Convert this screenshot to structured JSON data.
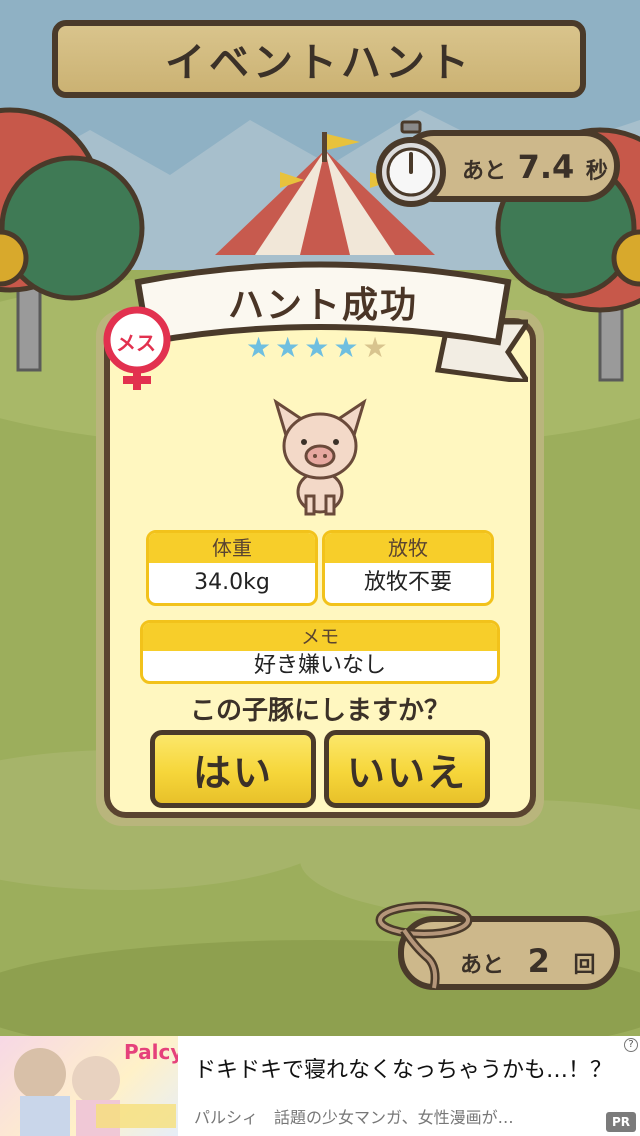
{
  "header": {
    "title": "イベントハント"
  },
  "timer": {
    "prefix": "あと",
    "value": "7.4",
    "unit": "秒"
  },
  "tries": {
    "prefix": "あと",
    "value": "2",
    "unit": "回"
  },
  "result": {
    "title": "ハント成功",
    "gender_label": "メス",
    "rating": 4,
    "rating_max": 5,
    "stars": [
      "★",
      "★",
      "★",
      "★",
      "★"
    ]
  },
  "stats": {
    "weight": {
      "label": "体重",
      "value": "34.0kg"
    },
    "grazing": {
      "label": "放牧",
      "value": "放牧不要"
    },
    "memo": {
      "label": "メモ",
      "value": "好き嫌いなし"
    }
  },
  "prompt": {
    "question": "この子豚にしますか？"
  },
  "buttons": {
    "yes": "はい",
    "no": "いいえ"
  },
  "ad": {
    "brand": "Palcy",
    "headline": "ドキドキで寝れなくなっちゃうかも…！？",
    "subtitle": "パルシィ　話題の少女マンガ、女性漫画が…",
    "pr_label": "PR",
    "info_icon": "?"
  },
  "colors": {
    "sky": "#8fb1c4",
    "grass": "#9bb05a",
    "card_bg": "#fff7c0",
    "button_yellow": "#f6d63a",
    "header_yellow": "#f7ce2a",
    "star_on": "#6fbfe0",
    "star_off": "#d8c48e",
    "female_pink": "#e2314f"
  }
}
